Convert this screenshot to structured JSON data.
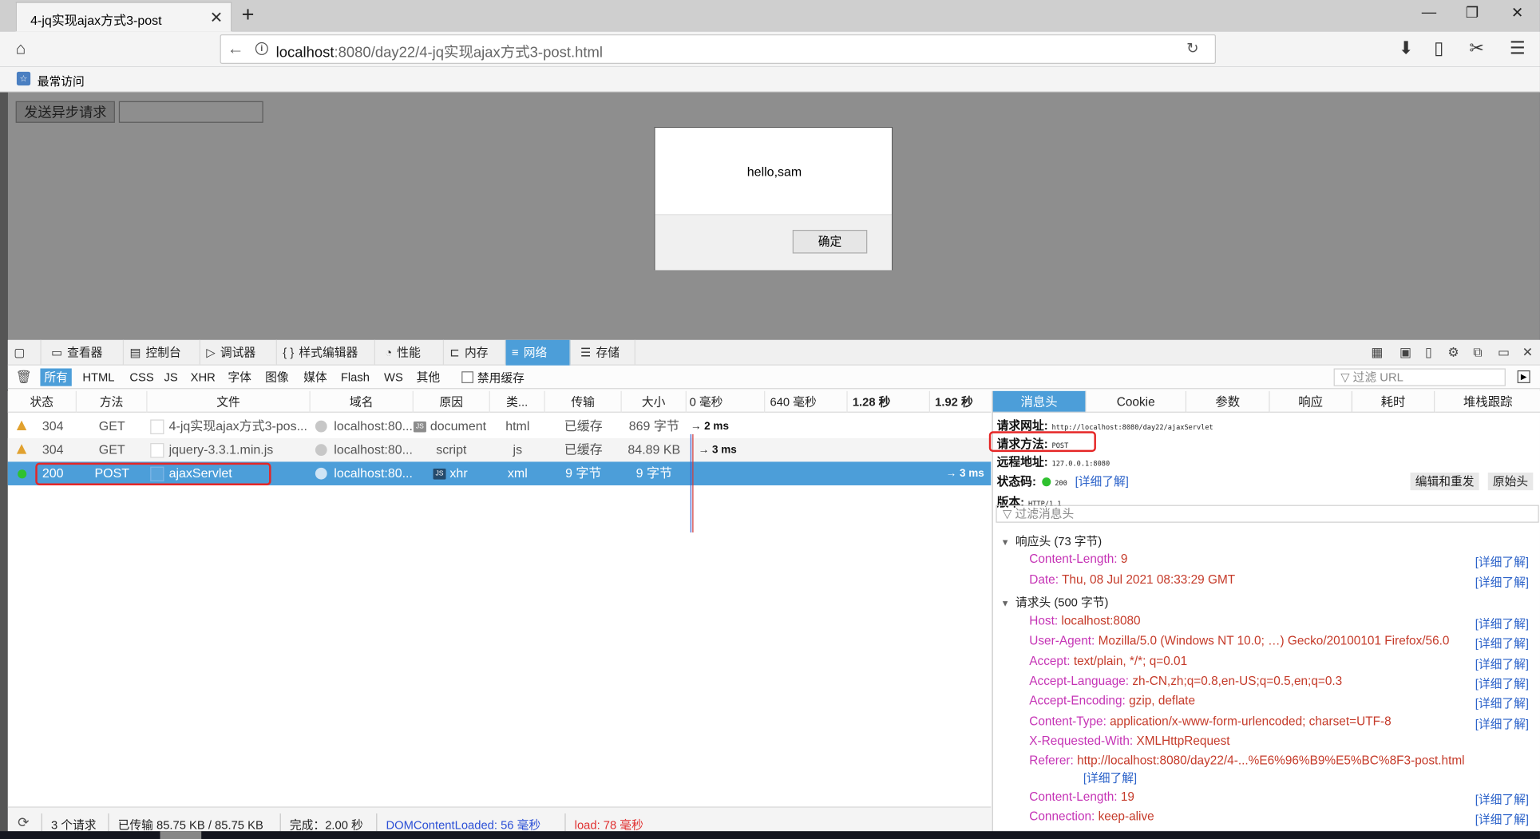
{
  "window": {
    "tab_title": "4-jq实现ajax方式3-post",
    "close_glyph": "✕",
    "new_tab_glyph": "+",
    "minimize_glyph": "—",
    "restore_glyph": "❐",
    "window_close_glyph": "✕"
  },
  "nav": {
    "home_glyph": "⌂",
    "back_glyph": "←",
    "url_host": "localhost",
    "url_rest": ":8080/day22/4-jq实现ajax方式3-post.html",
    "reload_glyph": "↻",
    "download_glyph": "⬇",
    "library_glyph": "▯",
    "screenshot_glyph": "✂",
    "menu_glyph": "☰"
  },
  "bookmarks": {
    "label": "最常访问"
  },
  "page": {
    "send_button": "发送异步请求",
    "input_value": ""
  },
  "dialog": {
    "message": "hello,sam",
    "ok": "确定"
  },
  "devtools": {
    "tabs": [
      {
        "icon": "▢",
        "label": ""
      },
      {
        "icon": "▭",
        "label": "查看器"
      },
      {
        "icon": "▤",
        "label": "控制台"
      },
      {
        "icon": "▷",
        "label": "调试器"
      },
      {
        "icon": "{ }",
        "label": "样式编辑器"
      },
      {
        "icon": "◔",
        "label": "性能"
      },
      {
        "icon": "⊏",
        "label": "内存"
      },
      {
        "icon": "≡",
        "label": "网络"
      },
      {
        "icon": "☰",
        "label": "存储"
      }
    ],
    "right_icons": [
      "▦",
      "▣",
      "▯",
      "⚙",
      "⧉",
      "▭",
      "✕"
    ],
    "filters": [
      "所有",
      "HTML",
      "CSS",
      "JS",
      "XHR",
      "字体",
      "图像",
      "媒体",
      "Flash",
      "WS",
      "其他"
    ],
    "disable_cache": "禁用缓存",
    "url_filter_placeholder": "▽ 过滤 URL"
  },
  "table": {
    "headers": [
      "状态",
      "方法",
      "文件",
      "域名",
      "原因",
      "类...",
      "传输",
      "大小"
    ],
    "timeline": [
      "0 毫秒",
      "640 毫秒",
      "1.28 秒",
      "1.92 秒"
    ],
    "rows": [
      {
        "status": "304",
        "method": "GET",
        "file": "4-jq实现ajax方式3-pos...",
        "domain": "localhost:80...",
        "cause": "document",
        "type": "html",
        "transferred": "已缓存",
        "size": "869 字节",
        "timing": "→ 2 ms"
      },
      {
        "status": "304",
        "method": "GET",
        "file": "jquery-3.3.1.min.js",
        "domain": "localhost:80...",
        "cause": "script",
        "type": "js",
        "transferred": "已缓存",
        "size": "84.89 KB",
        "timing": "→ 3 ms"
      },
      {
        "status": "200",
        "method": "POST",
        "file": "ajaxServlet",
        "domain": "localhost:80...",
        "cause": "xhr",
        "type": "xml",
        "transferred": "9 字节",
        "size": "9 字节",
        "timing": "→ 3 ms"
      }
    ],
    "js_badge": "JS"
  },
  "statusbar": {
    "requests": "3 个请求",
    "transferred": "已传输 85.75 KB / 85.75 KB",
    "finish": "完成：2.00 秒",
    "dcl": "DOMContentLoaded: 56 毫秒",
    "load": "load: 78 毫秒"
  },
  "detail": {
    "tabs": [
      "消息头",
      "Cookie",
      "参数",
      "响应",
      "耗时",
      "堆栈跟踪"
    ],
    "request_url_label": "请求网址:",
    "request_url": "http://localhost:8080/day22/ajaxServlet",
    "method_label": "请求方法:",
    "method": "POST",
    "remote_label": "远程地址:",
    "remote": "127.0.0.1:8080",
    "status_label": "状态码:",
    "status": "200",
    "learn_more": "[详细了解]",
    "version_label": "版本:",
    "version": "HTTP/1.1",
    "edit_resend": "编辑和重发",
    "raw_headers": "原始头",
    "header_filter_placeholder": "▽ 过滤消息头",
    "response_section": "响应头 (73 字节)",
    "request_section": "请求头 (500 字节)",
    "response_headers": [
      {
        "k": "Content-Length",
        "v": "9"
      },
      {
        "k": "Date",
        "v": "Thu, 08 Jul 2021 08:33:29 GMT"
      }
    ],
    "request_headers": [
      {
        "k": "Host",
        "v": "localhost:8080"
      },
      {
        "k": "User-Agent",
        "v": "Mozilla/5.0 (Windows NT 10.0; …) Gecko/20100101 Firefox/56.0"
      },
      {
        "k": "Accept",
        "v": "text/plain, */*; q=0.01"
      },
      {
        "k": "Accept-Language",
        "v": "zh-CN,zh;q=0.8,en-US;q=0.5,en;q=0.3"
      },
      {
        "k": "Accept-Encoding",
        "v": "gzip, deflate"
      },
      {
        "k": "Content-Type",
        "v": "application/x-www-form-urlencoded; charset=UTF-8"
      },
      {
        "k": "X-Requested-With",
        "v": "XMLHttpRequest"
      },
      {
        "k": "Referer",
        "v": "http://localhost:8080/day22/4-...%E6%96%B9%E5%BC%8F3-post.html"
      },
      {
        "k": "Content-Length",
        "v": "19"
      },
      {
        "k": "Connection",
        "v": "keep-alive"
      }
    ]
  },
  "colors": {
    "accent": "#4c9ed9",
    "header_key": "#c533b5",
    "header_value": "#c53a29",
    "link": "#2b62c9",
    "highlight_box": "#e52626"
  }
}
